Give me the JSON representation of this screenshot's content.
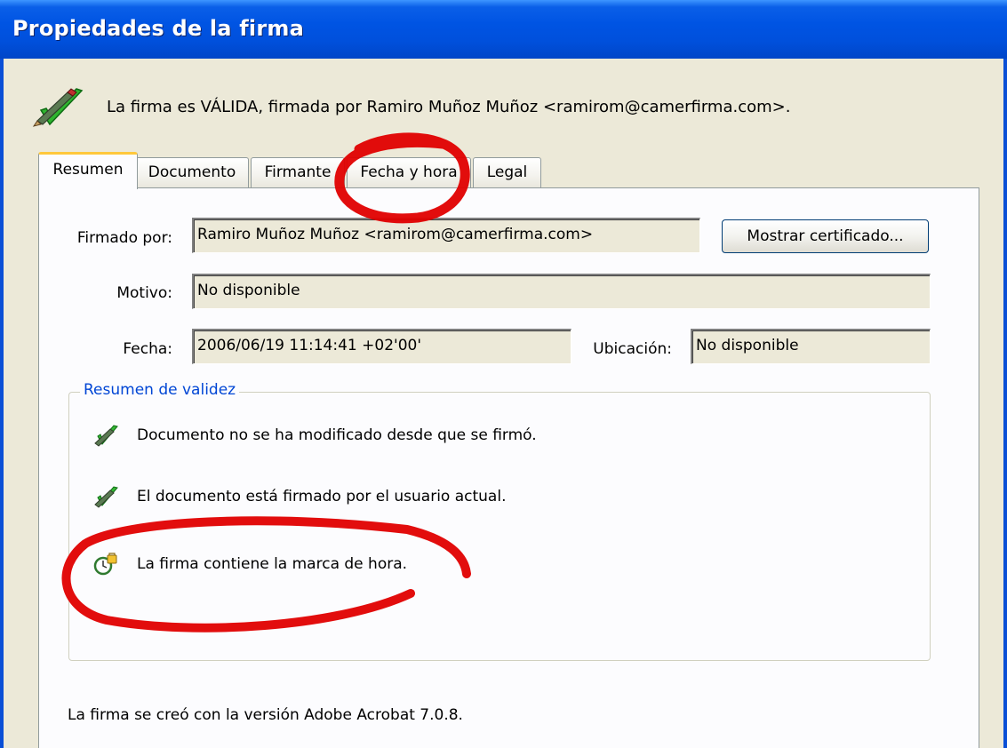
{
  "window": {
    "title": "Propiedades de la firma"
  },
  "status": {
    "text": "La firma es VÁLIDA, firmada por Ramiro Muñoz Muñoz <ramirom@camerfirma.com>.",
    "icon": "pen-checkmark-icon"
  },
  "tabs": [
    {
      "label": "Resumen",
      "active": true
    },
    {
      "label": "Documento",
      "active": false
    },
    {
      "label": "Firmante",
      "active": false
    },
    {
      "label": "Fecha y hora",
      "active": false
    },
    {
      "label": "Legal",
      "active": false
    }
  ],
  "summary": {
    "signed_by_label": "Firmado por:",
    "signed_by_value": "Ramiro Muñoz Muñoz <ramirom@camerfirma.com>",
    "show_certificate_button": "Mostrar certificado...",
    "reason_label": "Motivo:",
    "reason_value": "No disponible",
    "date_label": "Fecha:",
    "date_value": "2006/06/19 11:14:41 +02'00'",
    "location_label": "Ubicación:",
    "location_value": "No disponible"
  },
  "validity": {
    "legend": "Resumen de validez",
    "items": [
      {
        "text": "Documento no se ha modificado desde que se firmó.",
        "icon": "pen-check-icon"
      },
      {
        "text": "El documento está firmado por el usuario actual.",
        "icon": "pen-check-icon"
      },
      {
        "text": "La firma contiene la marca de hora.",
        "icon": "clock-lock-icon"
      }
    ]
  },
  "footer": {
    "text": "La firma se creó con la versión Adobe Acrobat 7.0.8."
  },
  "colors": {
    "title_bar": "#0054e3",
    "dialog_bg": "#ece9d8",
    "tab_highlight": "#ffc83c",
    "legend_text": "#0046d5",
    "annotation": "#e00000"
  }
}
